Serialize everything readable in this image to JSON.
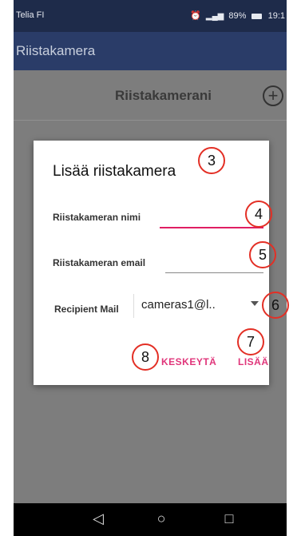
{
  "status_bar": {
    "carrier": "Telia FI",
    "alarm_icon": "alarm-icon",
    "signal_icon": "signal-icon",
    "battery": "89%",
    "time": "19:1"
  },
  "app_bar": {
    "title": "Riistakamera"
  },
  "content_header": {
    "title": "Riistakamerani",
    "add_icon": "plus-circle-icon"
  },
  "dialog": {
    "title": "Lisää riistakamera",
    "name_label": "Riistakameran nimi",
    "name_value": "",
    "email_label": "Riistakameran email",
    "email_value": "",
    "recipient_label": "Recipient Mail",
    "recipient_value": "cameras1@l..",
    "cancel_label": "KESKEYTÄ",
    "add_label": "LISÄÄ"
  },
  "markers": [
    "3",
    "4",
    "5",
    "6",
    "7",
    "8"
  ],
  "nav_bar": {
    "back_icon": "back-triangle-icon",
    "home_icon": "home-circle-icon",
    "recents_icon": "recents-square-icon"
  },
  "colors": {
    "status_bar": "#1e2b4a",
    "app_bar": "#2a3c68",
    "accent": "#e0357a",
    "marker": "#e32f25"
  }
}
